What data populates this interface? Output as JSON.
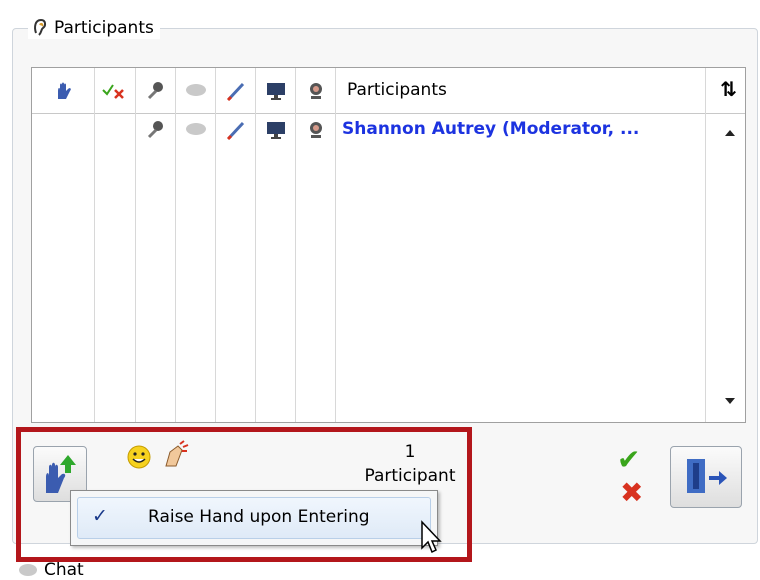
{
  "panel": {
    "title": "Participants"
  },
  "grid": {
    "header_label": "Participants",
    "sort_icon": "⇅",
    "columns": [
      "raise-hand-icon",
      "yes-no-icon",
      "microphone-icon",
      "chat-bubble-icon",
      "pen-icon",
      "monitor-icon",
      "webcam-icon"
    ],
    "rows": [
      {
        "name": "Shannon Autrey (Moderator, ..."
      }
    ]
  },
  "footer": {
    "count_number": "1",
    "count_label": "Participant"
  },
  "popup": {
    "check": "✓",
    "item_label": "Raise Hand upon Entering"
  },
  "bottom_tab": {
    "label": "Chat"
  },
  "colors": {
    "name_link": "#1c33e0",
    "highlight": "#b3161b",
    "check": "#3aa51c",
    "cross": "#d8321f"
  }
}
